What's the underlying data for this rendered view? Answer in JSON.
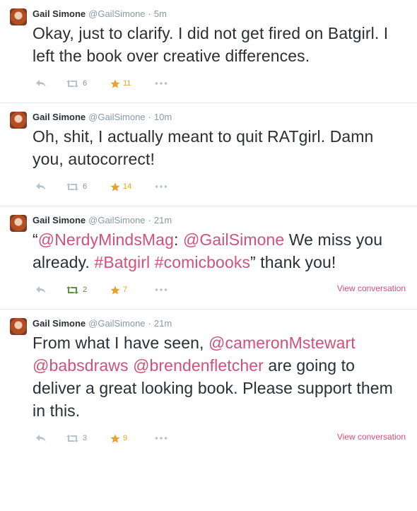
{
  "tweets": [
    {
      "fullname": "Gail Simone",
      "username": "@GailSimone",
      "time": "5m",
      "text_parts": [
        {
          "t": "Okay, just to clarify. I did not get fired on Batgirl. I left the book over creative differences.",
          "link": false
        }
      ],
      "retweets": "6",
      "retweeted": false,
      "favorites": "11",
      "view_conversation": ""
    },
    {
      "fullname": "Gail Simone",
      "username": "@GailSimone",
      "time": "10m",
      "text_parts": [
        {
          "t": "Oh, shit, I actually meant to quit RATgirl. Damn you, autocorrect!",
          "link": false
        }
      ],
      "retweets": "6",
      "retweeted": false,
      "favorites": "14",
      "view_conversation": ""
    },
    {
      "fullname": "Gail Simone",
      "username": "@GailSimone",
      "time": "21m",
      "text_parts": [
        {
          "t": "“",
          "link": false
        },
        {
          "t": "@NerdyMindsMag",
          "link": true
        },
        {
          "t": ": ",
          "link": false
        },
        {
          "t": "@GailSimone",
          "link": true
        },
        {
          "t": " We miss you already. ",
          "link": false
        },
        {
          "t": "#Batgirl",
          "link": true
        },
        {
          "t": " ",
          "link": false
        },
        {
          "t": "#comicbooks",
          "link": true
        },
        {
          "t": "” thank you!",
          "link": false
        }
      ],
      "retweets": "2",
      "retweeted": true,
      "favorites": "7",
      "view_conversation": "View conversation"
    },
    {
      "fullname": "Gail Simone",
      "username": "@GailSimone",
      "time": "21m",
      "text_parts": [
        {
          "t": "From what I have seen, ",
          "link": false
        },
        {
          "t": "@cameronMstewart",
          "link": true
        },
        {
          "t": "  ",
          "link": false
        },
        {
          "t": "@babsdraws",
          "link": true
        },
        {
          "t": " ",
          "link": false
        },
        {
          "t": "@brendenfletcher",
          "link": true
        },
        {
          "t": " are going to deliver a great looking book. Please support them in this.",
          "link": false
        }
      ],
      "retweets": "3",
      "retweeted": false,
      "favorites": "9",
      "view_conversation": "View conversation"
    }
  ],
  "icons": {
    "reply": "reply-icon",
    "retweet": "retweet-icon",
    "favorite": "star-icon",
    "more": "more-icon"
  },
  "colors": {
    "link": "#d2507a",
    "retweet_active": "#5c9141",
    "favorite": "#e8a030",
    "muted": "#8899a6"
  }
}
